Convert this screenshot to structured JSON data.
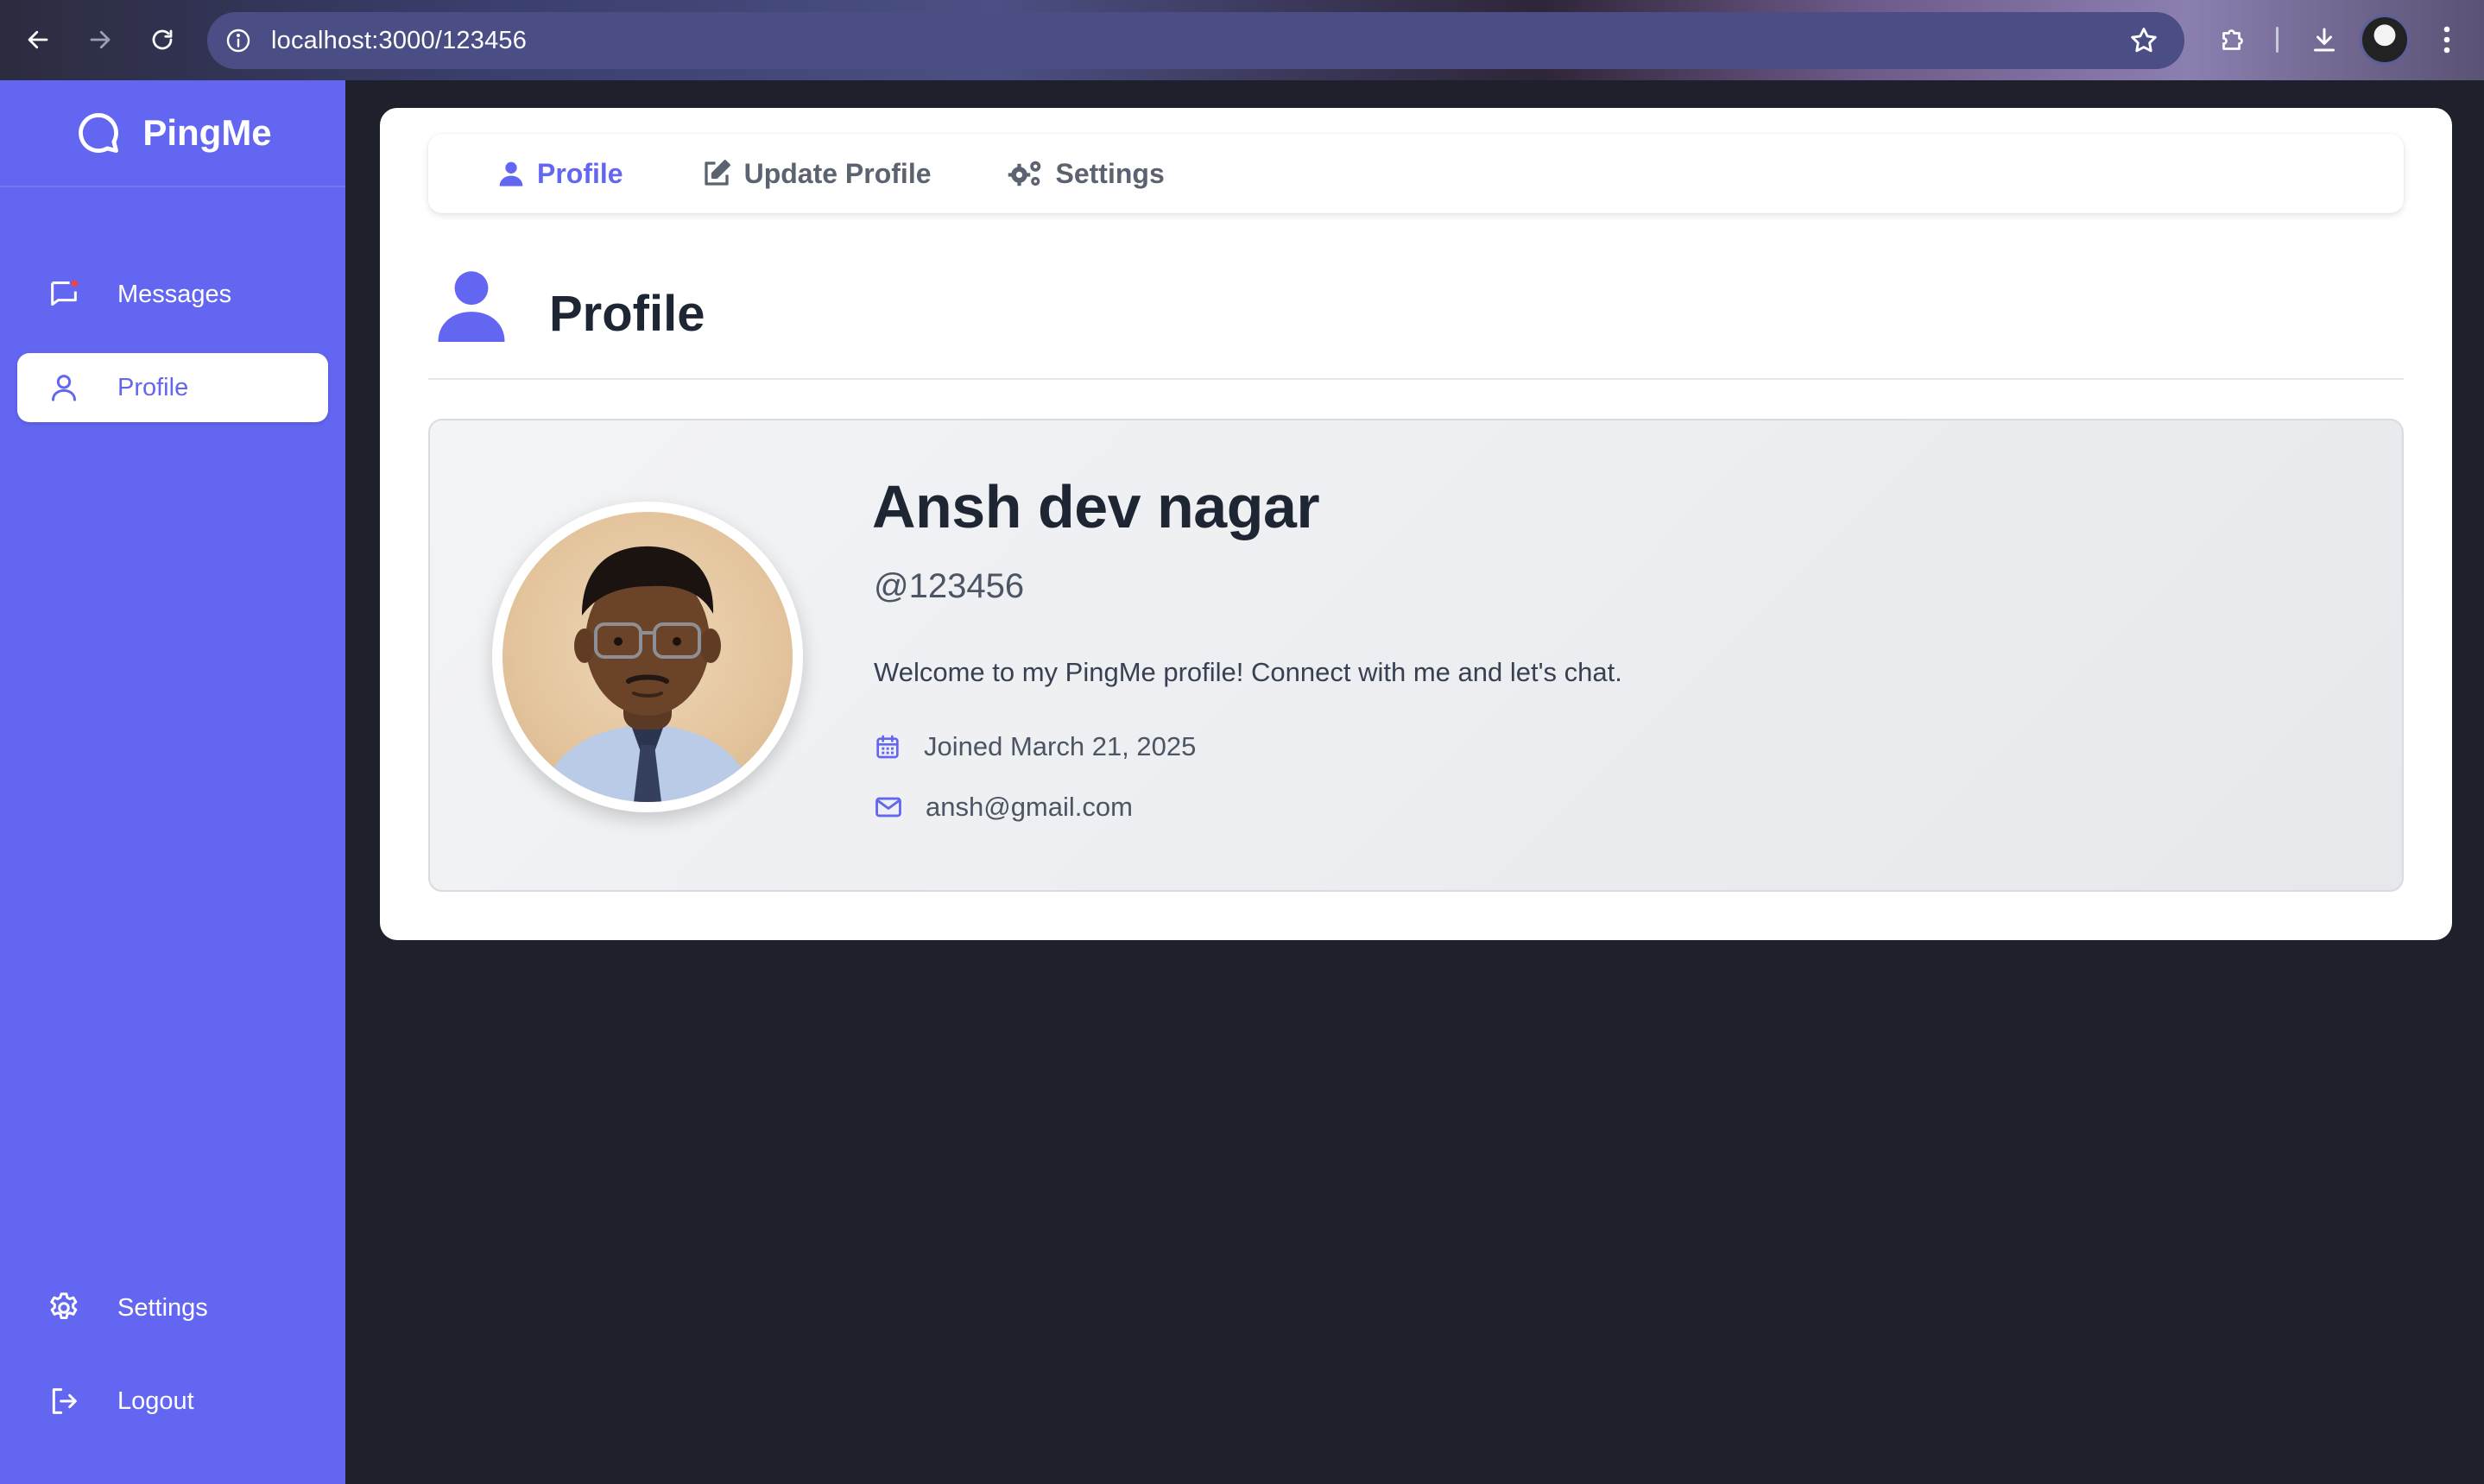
{
  "browser": {
    "url": "localhost:3000/123456"
  },
  "sidebar": {
    "brand": "PingMe",
    "items": [
      {
        "label": "Messages",
        "icon": "message-square-icon"
      },
      {
        "label": "Profile",
        "icon": "user-icon",
        "active": true
      }
    ],
    "bottom_items": [
      {
        "label": "Settings",
        "icon": "gear-icon"
      },
      {
        "label": "Logout",
        "icon": "logout-icon"
      }
    ]
  },
  "tabs": [
    {
      "label": "Profile",
      "icon": "user-icon",
      "active": true
    },
    {
      "label": "Update Profile",
      "icon": "edit-icon"
    },
    {
      "label": "Settings",
      "icon": "gears-icon"
    }
  ],
  "page": {
    "title": "Profile"
  },
  "profile": {
    "name": "Ansh dev nagar",
    "handle": "@123456",
    "bio": "Welcome to my PingMe profile! Connect with me and let's chat.",
    "joined": "Joined March 21, 2025",
    "email": "ansh@gmail.com"
  },
  "colors": {
    "accent": "#6366f1",
    "background": "#1e202b",
    "text_dark": "#1f2633",
    "text_muted": "#4b5563"
  }
}
